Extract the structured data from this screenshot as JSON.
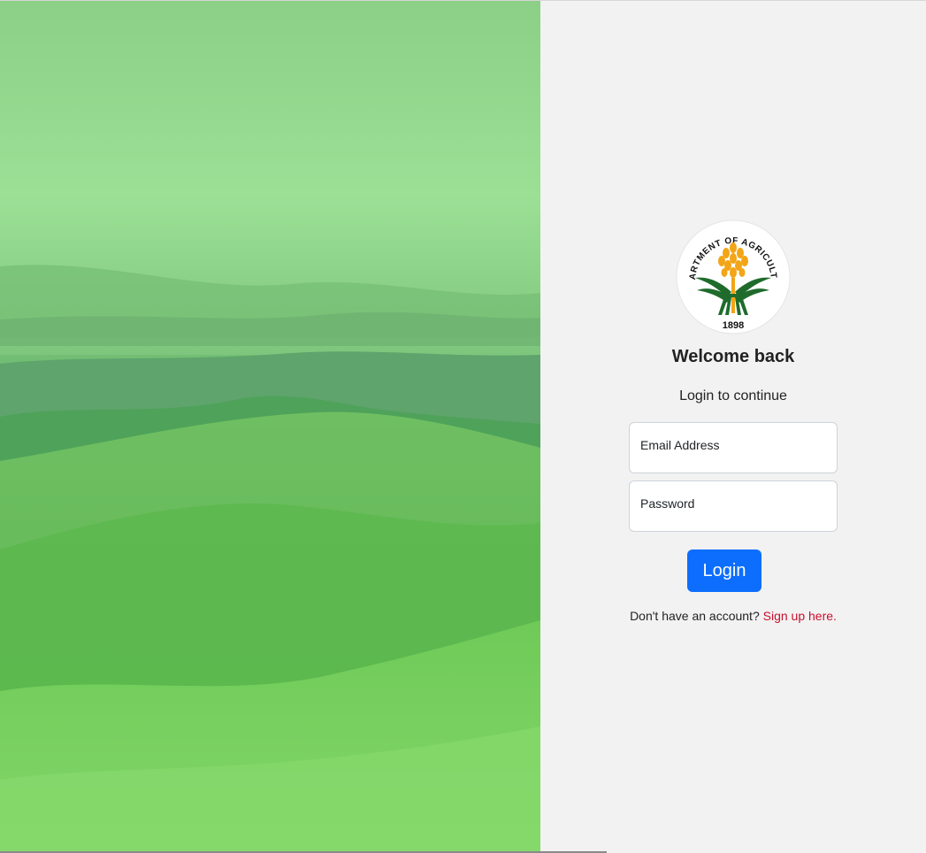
{
  "logo": {
    "arc_text": "DEPARTMENT OF AGRICULTURE",
    "year": "1898"
  },
  "login": {
    "title": "Welcome back",
    "subtitle": "Login to continue",
    "email_label": "Email Address",
    "password_label": "Password",
    "button_label": "Login",
    "signup_prompt": "Don't have an account?",
    "signup_link": "Sign up here."
  },
  "colors": {
    "primary_button": "#0d6efd",
    "link": "#c8102e",
    "panel_background": "#f2f2f2",
    "hero_overlay": "#7fd07a"
  }
}
